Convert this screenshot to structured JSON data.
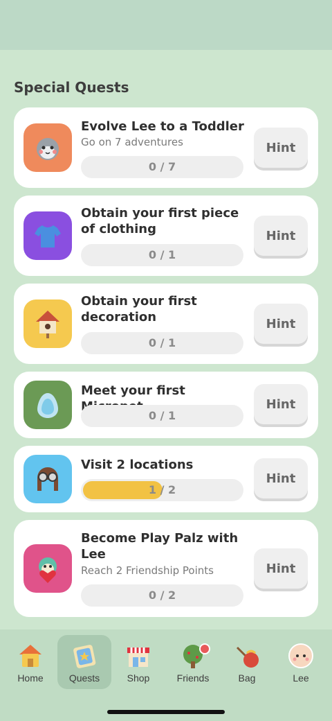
{
  "header": {
    "title": "Special Quests"
  },
  "quests": [
    {
      "title": "Evolve Lee to a Toddler",
      "subtitle": "Go on 7 adventures",
      "progress": "0 / 7",
      "progress_fraction": 0,
      "hint": "Hint",
      "icon": "pet-face-icon",
      "icon_color": "#ef8a5c"
    },
    {
      "title": "Obtain your first piece of clothing",
      "subtitle": "",
      "progress": "0 / 1",
      "progress_fraction": 0,
      "hint": "Hint",
      "icon": "shirt-icon",
      "icon_color": "#8a4fe0"
    },
    {
      "title": "Obtain your first decoration",
      "subtitle": "",
      "progress": "0 / 1",
      "progress_fraction": 0,
      "hint": "Hint",
      "icon": "birdhouse-icon",
      "icon_color": "#f5c94f"
    },
    {
      "title": "Meet your first Micropet",
      "subtitle": "",
      "progress": "0 / 1",
      "progress_fraction": 0,
      "hint": "Hint",
      "icon": "egg-icon",
      "icon_color": "#6b9a55"
    },
    {
      "title": "Visit 2 locations",
      "subtitle": "",
      "progress": "1 / 2",
      "progress_fraction": 0.5,
      "hint": "Hint",
      "icon": "aviator-helmet-icon",
      "icon_color": "#62c4ef"
    },
    {
      "title": "Become Play Palz with Lee",
      "subtitle": "Reach 2 Friendship Points",
      "progress": "0 / 2",
      "progress_fraction": 0,
      "hint": "Hint",
      "icon": "friend-heart-icon",
      "icon_color": "#e0538a"
    }
  ],
  "nav": {
    "items": [
      {
        "label": "Home",
        "icon": "home-icon",
        "active": false
      },
      {
        "label": "Quests",
        "icon": "quests-icon",
        "active": true
      },
      {
        "label": "Shop",
        "icon": "shop-icon",
        "active": false
      },
      {
        "label": "Friends",
        "icon": "friends-tree-icon",
        "active": false,
        "notification": true
      },
      {
        "label": "Bag",
        "icon": "bag-icon",
        "active": false
      },
      {
        "label": "Lee",
        "icon": "lee-face-icon",
        "active": false
      }
    ]
  },
  "colors": {
    "background": "#cde6cf",
    "card": "#ffffff",
    "progress_fill": "#f2c244",
    "nav_active": "#a9c9b0"
  }
}
